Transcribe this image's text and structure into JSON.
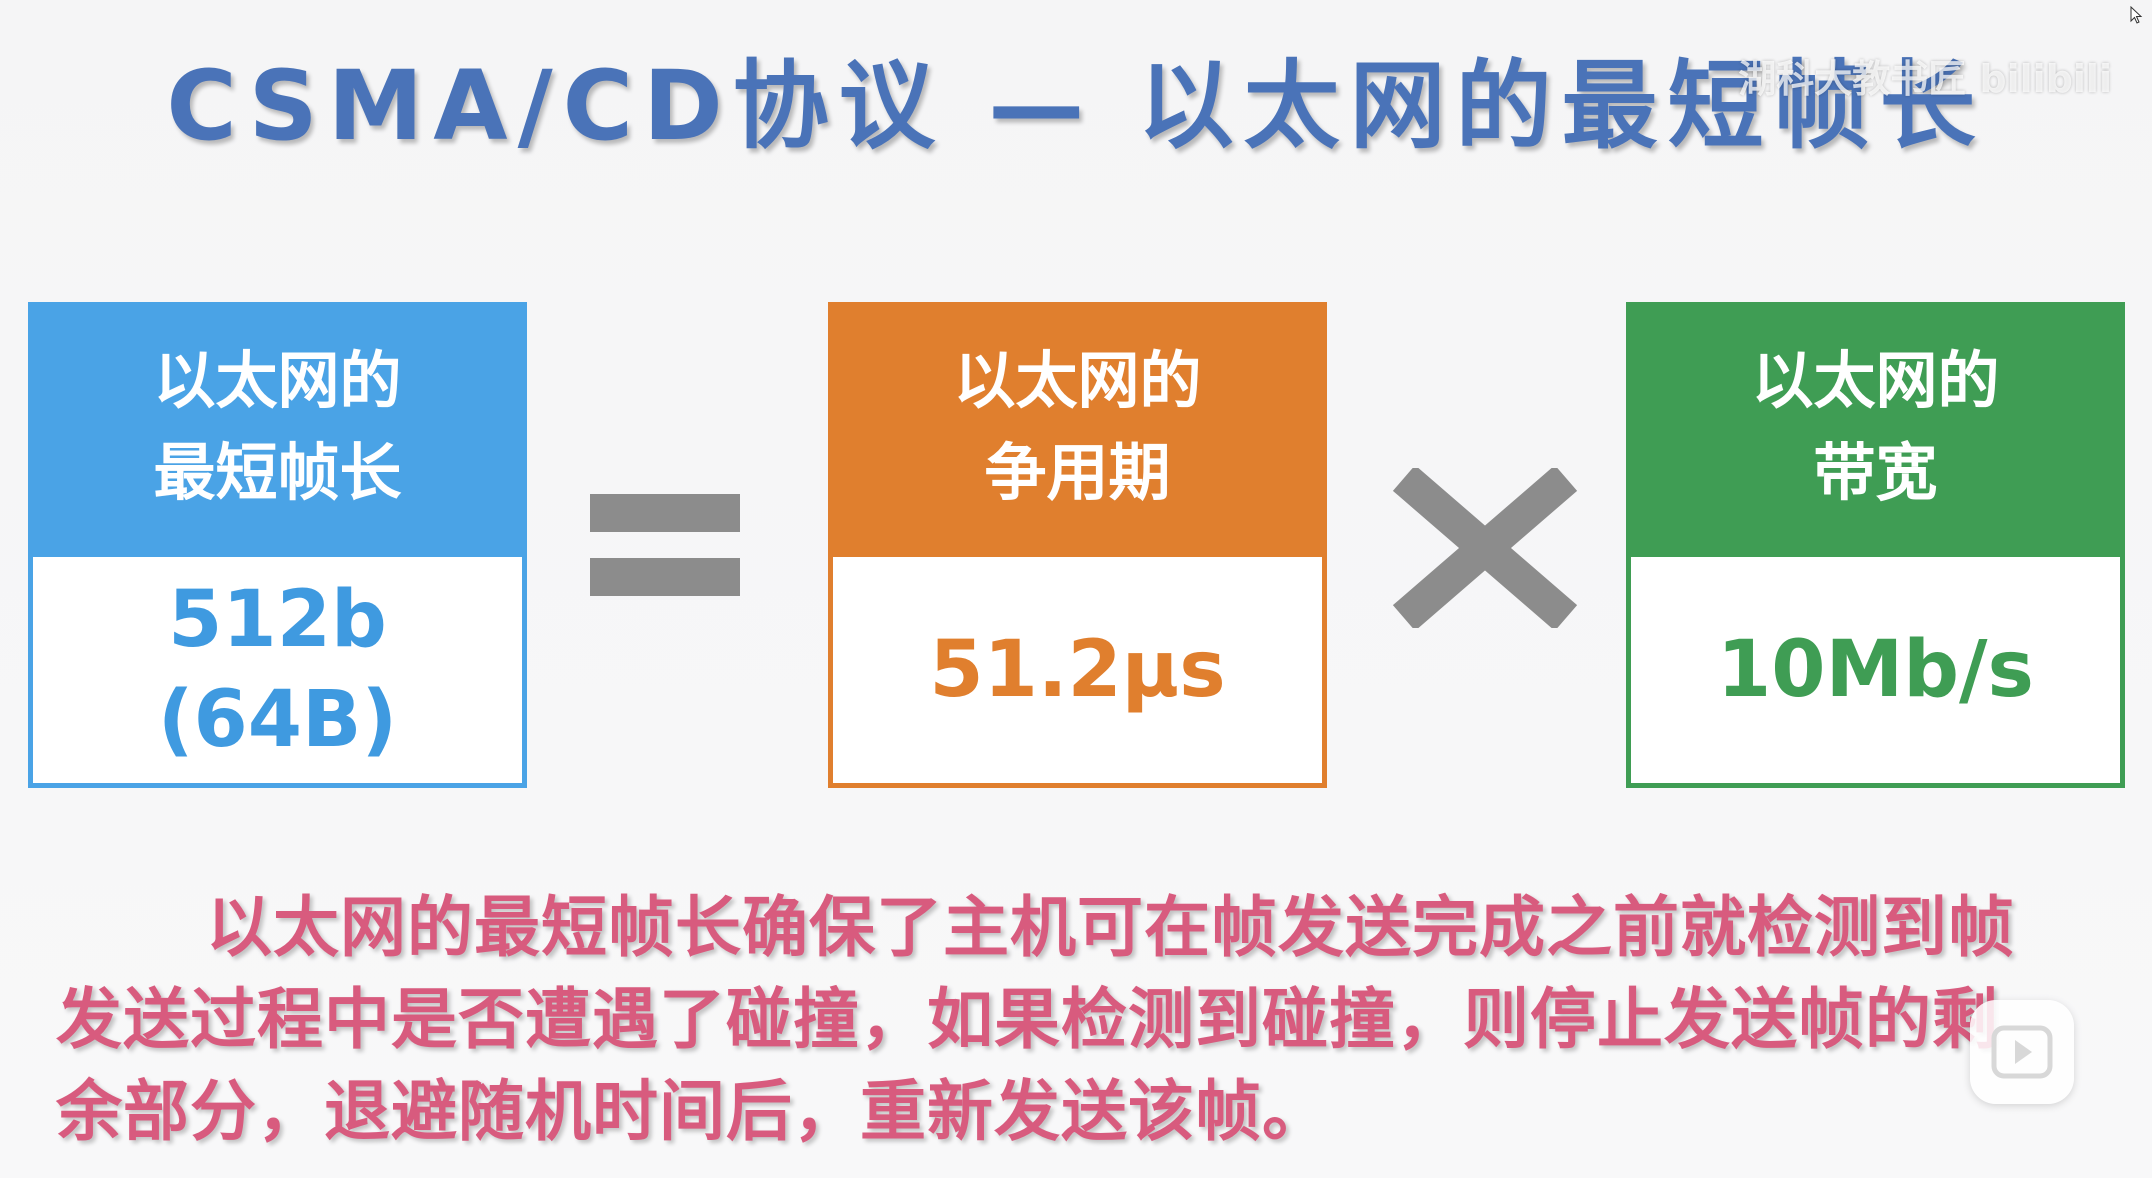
{
  "title": "CSMA/CD协议 — 以太网的最短帧长",
  "watermark": "湖科大教书匠 bilibili",
  "boxes": {
    "min_frame": {
      "head_line1": "以太网的",
      "head_line2": "最短帧长",
      "value_line1": "512b",
      "value_line2": "(64B)",
      "color": "#4aa3e6"
    },
    "contention": {
      "head_line1": "以太网的",
      "head_line2": "争用期",
      "value": "51.2μs",
      "color": "#e07f2e"
    },
    "bandwidth": {
      "head_line1": "以太网的",
      "head_line2": "带宽",
      "value": "10Mb/s",
      "color": "#3f9d54"
    }
  },
  "operators": {
    "equals_icon": "equals-icon",
    "times_icon": "times-icon"
  },
  "description": "以太网的最短帧长确保了主机可在帧发送完成之前就检测到帧发送过程中是否遭遇了碰撞，如果检测到碰撞，则停止发送帧的剩余部分，退避随机时间后，重新发送该帧。"
}
